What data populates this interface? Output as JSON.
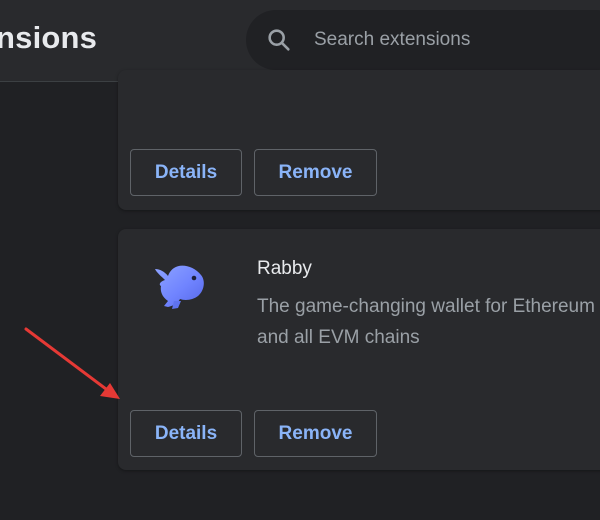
{
  "header": {
    "title": "nsions",
    "search": {
      "placeholder": "Search extensions",
      "value": "",
      "icon": "search-icon"
    }
  },
  "cards": [
    {
      "buttons": {
        "details": "Details",
        "remove": "Remove"
      }
    },
    {
      "name": "Rabby",
      "description": "The game-changing wallet for Ethereum and all EVM chains",
      "icon": "rabbit-icon",
      "buttons": {
        "details": "Details",
        "remove": "Remove"
      }
    }
  ],
  "annotation": {
    "icon": "red-arrow-icon",
    "color": "#e53935"
  },
  "colors": {
    "accent": "#8ab4f8",
    "background": "#202124",
    "card": "#292a2d"
  }
}
